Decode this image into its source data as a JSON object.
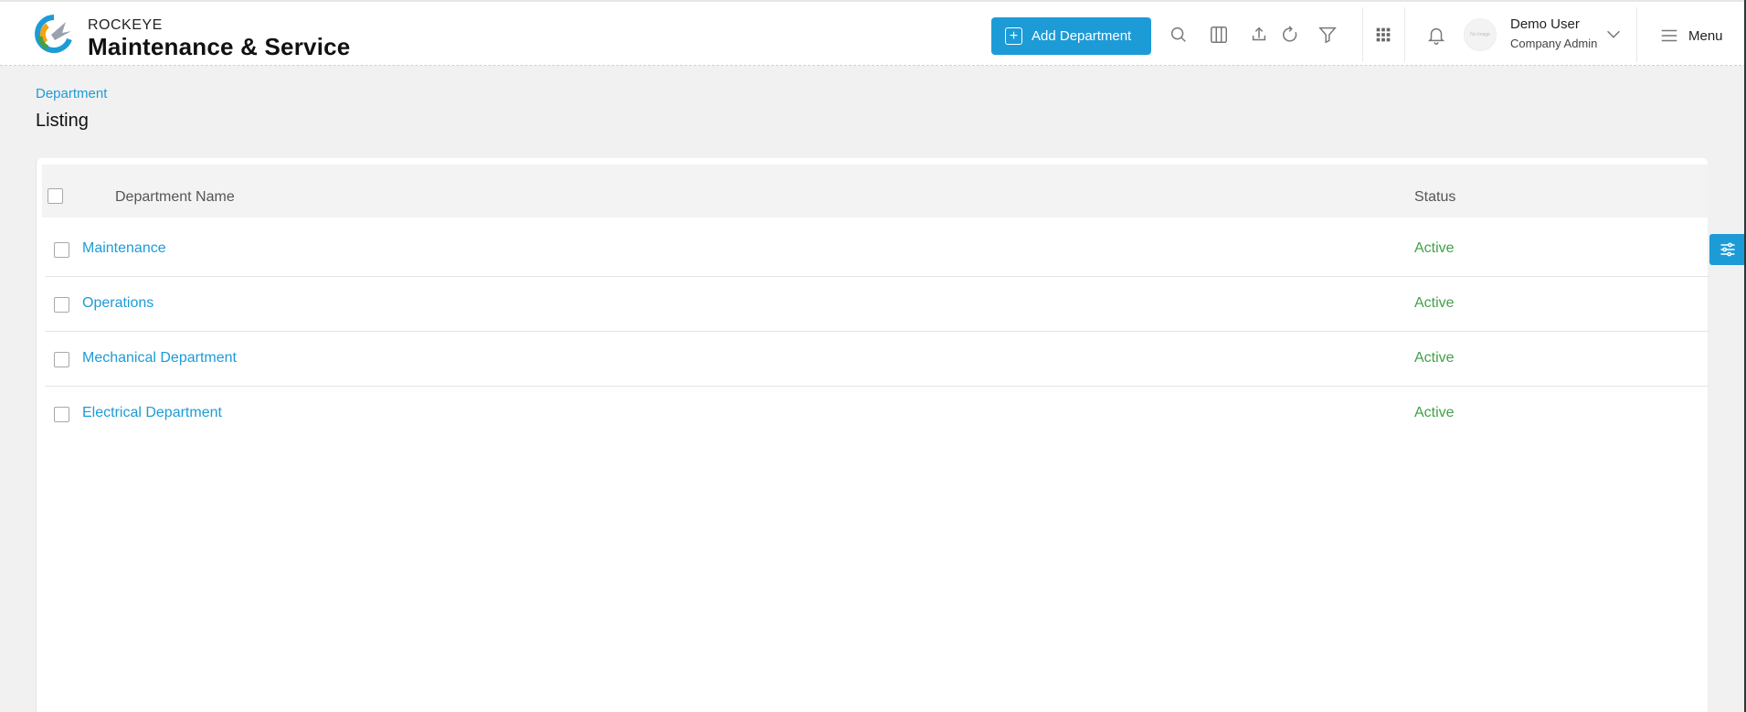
{
  "header": {
    "brand_small": "ROCKEYE",
    "brand_big": "Maintenance & Service",
    "add_button_label": "Add Department",
    "user_name": "Demo User",
    "user_role": "Company Admin",
    "avatar_text": "No Image",
    "menu_label": "Menu"
  },
  "breadcrumb": "Department",
  "page_title": "Listing",
  "table": {
    "columns": [
      "Department Name",
      "Status"
    ],
    "rows": [
      {
        "name": "Maintenance",
        "status": "Active"
      },
      {
        "name": "Operations",
        "status": "Active"
      },
      {
        "name": "Mechanical Department",
        "status": "Active"
      },
      {
        "name": "Electrical Department",
        "status": "Active"
      }
    ]
  },
  "colors": {
    "accent": "#1d9bd7",
    "active_status": "#43a047"
  },
  "icons": [
    "search-icon",
    "columns-icon",
    "upload-icon",
    "refresh-icon",
    "filter-icon",
    "apps-grid-icon",
    "bell-icon",
    "chevron-down-icon",
    "hamburger-icon",
    "filter-sliders-icon"
  ]
}
